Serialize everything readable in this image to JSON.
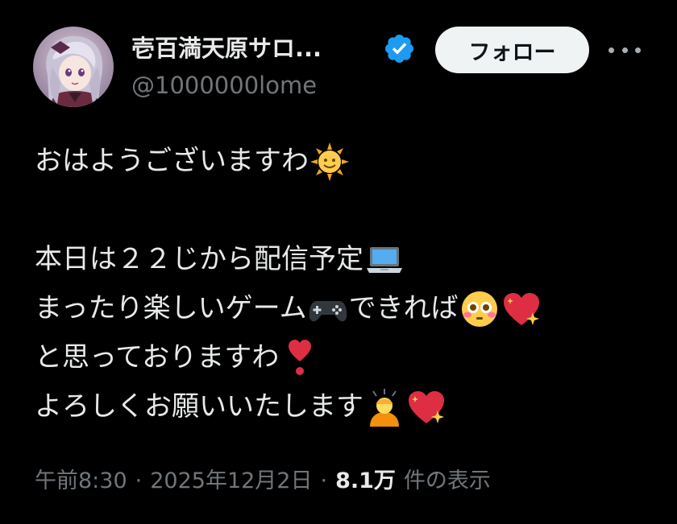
{
  "author": {
    "display_name": "壱百満天原サロ...",
    "handle": "@1000000lome",
    "verified_icon": "verified-badge-icon",
    "avatar_icon": "avatar"
  },
  "header": {
    "follow_label": "フォロー",
    "more_icon": "more-dots-icon"
  },
  "tweet": {
    "lines": [
      {
        "text": "おはようございますわ",
        "emoji": [
          "sun-face-emoji"
        ]
      },
      {
        "text": "",
        "emoji": []
      },
      {
        "text": "本日は２２じから配信予定",
        "emoji": [
          "laptop-emoji"
        ]
      },
      {
        "text": "まったり楽しいゲーム",
        "emoji": [
          "game-controller-emoji"
        ],
        "after": "できれば",
        "emoji2": [
          "flushed-face-emoji",
          "sparkling-heart-emoji"
        ]
      },
      {
        "text": "と思っておりますわ",
        "emoji": [
          "exclamation-heart-emoji"
        ]
      },
      {
        "text": "よろしくお願いいたします",
        "emoji": [
          "bowing-person-emoji",
          "sparkling-heart-emoji"
        ]
      }
    ]
  },
  "meta": {
    "time": "午前8:30",
    "date": "2025年12月2日",
    "separator": "·",
    "views_count": "8.1万",
    "views_label": "件の表示"
  },
  "colors": {
    "background": "#000000",
    "text_primary": "#e7e9ea",
    "text_secondary": "#71767b",
    "verified_blue": "#1d9bf0",
    "follow_bg": "#eff3f4"
  }
}
